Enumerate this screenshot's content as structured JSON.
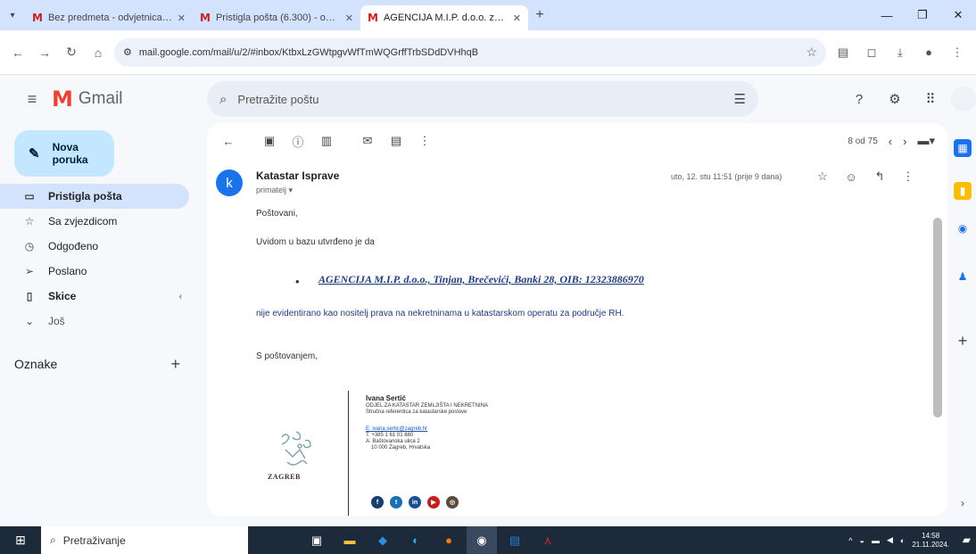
{
  "browser": {
    "tabs": [
      {
        "title": "Bez predmeta - odvjetnica.po",
        "active": false
      },
      {
        "title": "Pristigla pošta (6.300) - odvjet",
        "active": false
      },
      {
        "title": "AGENCIJA M.I.P. d.o.o. zadaje",
        "active": true
      }
    ],
    "url": "mail.google.com/mail/u/2/#inbox/KtbxLzGWtpgvWfTmWQGrffTrbSDdDVHhqB",
    "new_tab_label": "+"
  },
  "gmail": {
    "app_name": "Gmail",
    "search_placeholder": "Pretražite poštu",
    "compose_label": "Nova poruka",
    "nav": [
      {
        "label": "Pristigla pošta",
        "icon": "inbox-icon",
        "active": true
      },
      {
        "label": "Sa zvjezdicom",
        "icon": "star-icon",
        "active": false
      },
      {
        "label": "Odgođeno",
        "icon": "clock-icon",
        "active": false
      },
      {
        "label": "Poslano",
        "icon": "send-icon",
        "active": false
      },
      {
        "label": "Skice",
        "icon": "draft-icon",
        "active": false
      },
      {
        "label": "Još",
        "icon": "chevron-down-icon",
        "active": false
      }
    ],
    "labels_heading": "Oznake",
    "pager": "8 od 75"
  },
  "message": {
    "sender_initial": "k",
    "sender_name": "Katastar Isprave",
    "recipient": "primatelj",
    "date": "uto, 12. stu 11:51 (prije 9 dana)",
    "greeting": "Poštovani,",
    "intro": "Uvidom u bazu utvrđeno je da",
    "bullet": "AGENCIJA M.I.P. d.o.o., Tinjan, Brečevići, Banki 28, OIB: 12323886970",
    "statement": "nije evidentirano kao nositelj prava na nekretninama u katastarskom operatu za područje RH.",
    "closing": "S poštovanjem,",
    "signature": {
      "name": "Ivana Sertić",
      "department": "ODJEL ZA KATASTAR ZEMLJIŠTA I NEKRETNINA",
      "role": "Stručna referentica za katastarske poslove",
      "email": "E: ivana.sertic@zagreb.hr",
      "phone": "T: +385 1 61 01 880",
      "address1": "A: Baštovanska ulica 2",
      "address2": "10 000 Zagreb, Hrvatska",
      "city_logo_text": "ZAGREB"
    }
  },
  "taskbar": {
    "search_placeholder": "Pretraživanje",
    "time": "14:58",
    "date": "21.11.2024."
  }
}
